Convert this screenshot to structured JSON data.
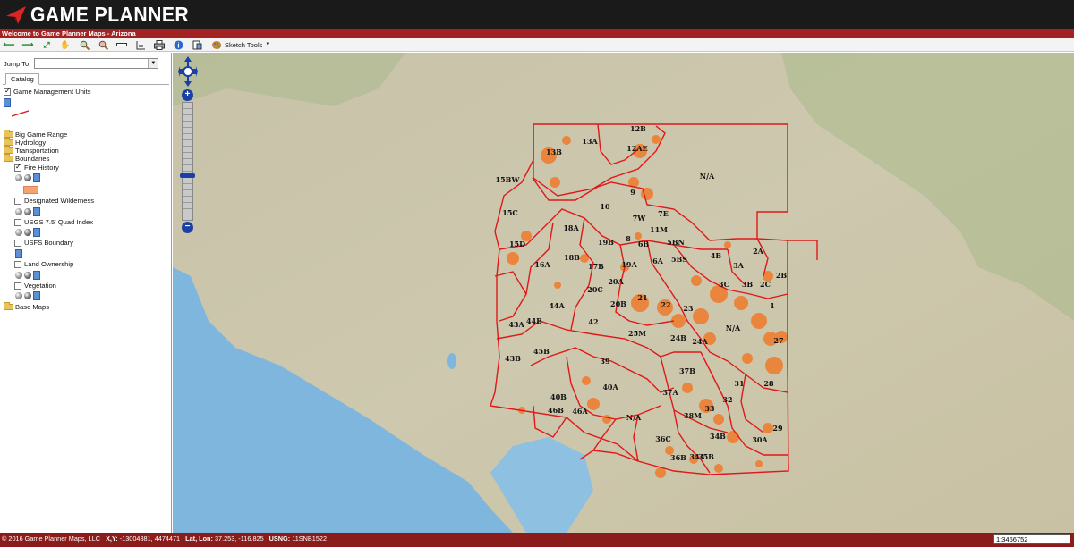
{
  "header": {
    "logo_text": "GAME PLANNER"
  },
  "welcome_text": "Welcome to Game Planner Maps - Arizona",
  "toolbar": {
    "buttons": [
      "back-arrow-icon",
      "forward-arrow-icon",
      "full-extent-icon",
      "pan-hand-icon",
      "zoom-in-icon",
      "zoom-out-icon",
      "measure-ruler-icon",
      "elevation-profile-icon",
      "print-icon",
      "info-icon",
      "layers-icon"
    ],
    "sketch_label": "Sketch Tools"
  },
  "sidebar": {
    "jump_label": "Jump To:",
    "jump_value": "",
    "tab_label": "Catalog",
    "layers": {
      "gmu": "Game Management Units",
      "big_game": "Big Game Range",
      "hydrology": "Hydrology",
      "transportation": "Transportation",
      "boundaries": "Boundaries",
      "fire_history": "Fire History",
      "wilderness": "Designated Wilderness",
      "usgs": "USGS 7.5' Quad Index",
      "usfs": "USFS Boundary",
      "land_ownership": "Land Ownership",
      "vegetation": "Vegetation",
      "base_maps": "Base Maps"
    }
  },
  "map": {
    "units": [
      "12B",
      "13A",
      "13B",
      "12AE",
      "15BW",
      "9",
      "10",
      "N/A",
      "15C",
      "7W",
      "7E",
      "18A",
      "11M",
      "15D",
      "19B",
      "8",
      "6B",
      "5BN",
      "16A",
      "18B",
      "17B",
      "19A",
      "6A",
      "5BS",
      "4B",
      "3A",
      "2A",
      "2B",
      "20A",
      "3C",
      "3B",
      "2C",
      "20C",
      "21",
      "44A",
      "20B",
      "22",
      "23",
      "1",
      "43A",
      "44B",
      "42",
      "N/A",
      "25M",
      "24B",
      "24A",
      "27",
      "43B",
      "45B",
      "39",
      "37B",
      "31",
      "28",
      "40A",
      "37A",
      "40B",
      "32",
      "33",
      "46B",
      "46A",
      "N/A",
      "38M",
      "36C",
      "34B",
      "29",
      "30A",
      "34A",
      "36B",
      "35B"
    ]
  },
  "footer": {
    "copyright": "© 2016 Game Planner Maps, LLC",
    "xy_label": "X,Y:",
    "xy_value": "-13004881, 4474471",
    "latlon_label": "Lat, Lon:",
    "latlon_value": "37.253, -116.825",
    "usng_label": "USNG:",
    "usng_value": "11SNB1522",
    "scale": "1:3466752"
  },
  "colors": {
    "header": "#1a1a1a",
    "welcome_bar": "#a52222",
    "footer": "#8b1c1c",
    "unit_border": "#e01818",
    "fire": "#f07a2a"
  }
}
